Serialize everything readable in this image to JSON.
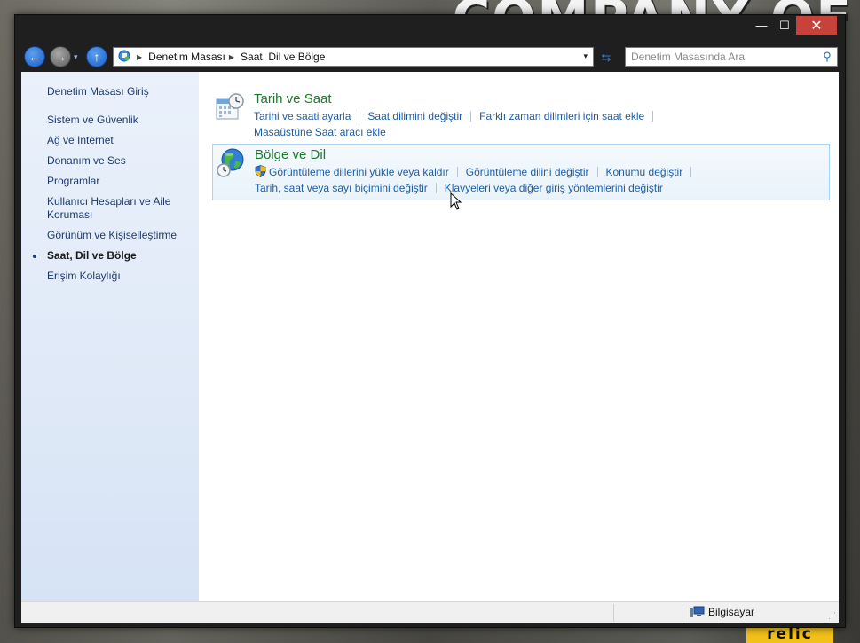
{
  "window": {
    "caption": {
      "minimize": "—",
      "maximize": "☐",
      "close": "✕"
    }
  },
  "navbar": {
    "back_glyph": "←",
    "forward_glyph": "→",
    "dropdown_glyph": "▾",
    "up_glyph": "↑",
    "breadcrumb": [
      "Denetim Masası",
      "Saat, Dil ve Bölge"
    ],
    "crumb_sep_glyph": "▶",
    "address_drop_glyph": "▾",
    "refresh_glyph": "⇆",
    "search": {
      "placeholder": "Denetim Masasında Ara"
    },
    "search_glyph": "⚲"
  },
  "sidebar": {
    "items": [
      {
        "label": "Denetim Masası Giriş"
      },
      {
        "label": "Sistem ve Güvenlik"
      },
      {
        "label": "Ağ ve Internet"
      },
      {
        "label": "Donanım ve Ses"
      },
      {
        "label": "Programlar"
      },
      {
        "label": "Kullanıcı Hesapları ve Aile Koruması"
      },
      {
        "label": "Görünüm ve Kişiselleştirme"
      },
      {
        "label": "Saat, Dil ve Bölge",
        "active": true
      },
      {
        "label": "Erişim Kolaylığı"
      }
    ]
  },
  "categories": [
    {
      "title": "Tarih ve Saat",
      "icon": "calendar-clock-icon",
      "rows": [
        [
          "Tarihi ve saati ayarla",
          "Saat dilimini değiştir",
          "Farklı zaman dilimleri için saat ekle"
        ],
        [
          "Masaüstüne Saat aracı ekle"
        ]
      ]
    },
    {
      "title": "Bölge ve Dil",
      "icon": "globe-clock-icon",
      "rows": [
        [
          "Görüntüleme dillerini yükle veya kaldır",
          "Görüntüleme dilini değiştir",
          "Konumu değiştir"
        ],
        [
          "Tarih, saat veya sayı biçimini değiştir",
          "Klavyeleri veya diğer giriş yöntemlerini değiştir"
        ]
      ]
    }
  ],
  "statusbar": {
    "computer_label": "Bilgisayar",
    "grip_glyph": "⋰"
  },
  "wallpaper": {
    "text": "COMPANY OF",
    "badge": "relic"
  },
  "colors": {
    "category_title": "#1c7a2a",
    "task_link": "#1d5ea8",
    "close_button": "#c7423b",
    "sidebar_link": "#1e3a6e"
  }
}
